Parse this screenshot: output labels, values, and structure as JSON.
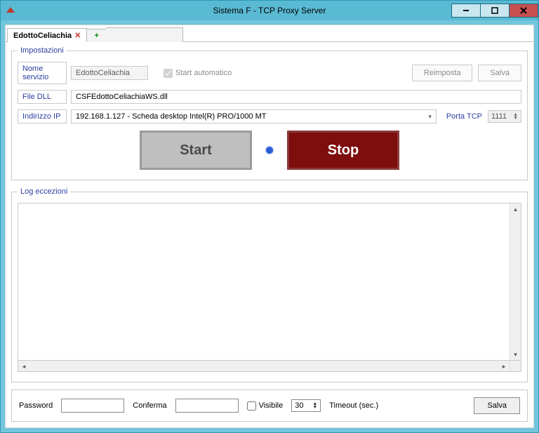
{
  "window": {
    "title": "Sistema F - TCP Proxy Server"
  },
  "tabs": {
    "active_label": "EdottoCeliachia",
    "close_glyph": "✕",
    "add_glyph": "+"
  },
  "settings": {
    "legend": "Impostazioni",
    "service_label": "Nome servizio",
    "service_value": "EdottoCeliachia",
    "autostart_label": "Start automatico",
    "reset_btn": "Reimposta",
    "save_btn": "Salva",
    "filedll_label": "File DLL",
    "filedll_value": "CSFEdottoCeliachiaWS.dll",
    "ip_label": "Indirizzo IP",
    "ip_value": "192.168.1.127 - Scheda desktop Intel(R) PRO/1000 MT",
    "port_label": "Porta TCP",
    "port_value": "1111",
    "start_btn": "Start",
    "stop_btn": "Stop"
  },
  "log": {
    "legend": "Log eccezioni"
  },
  "footer": {
    "password_label": "Password",
    "confirm_label": "Conferma",
    "visible_label": "Visibile",
    "timeout_value": "30",
    "timeout_label": "Timeout (sec.)",
    "save_btn": "Salva"
  }
}
